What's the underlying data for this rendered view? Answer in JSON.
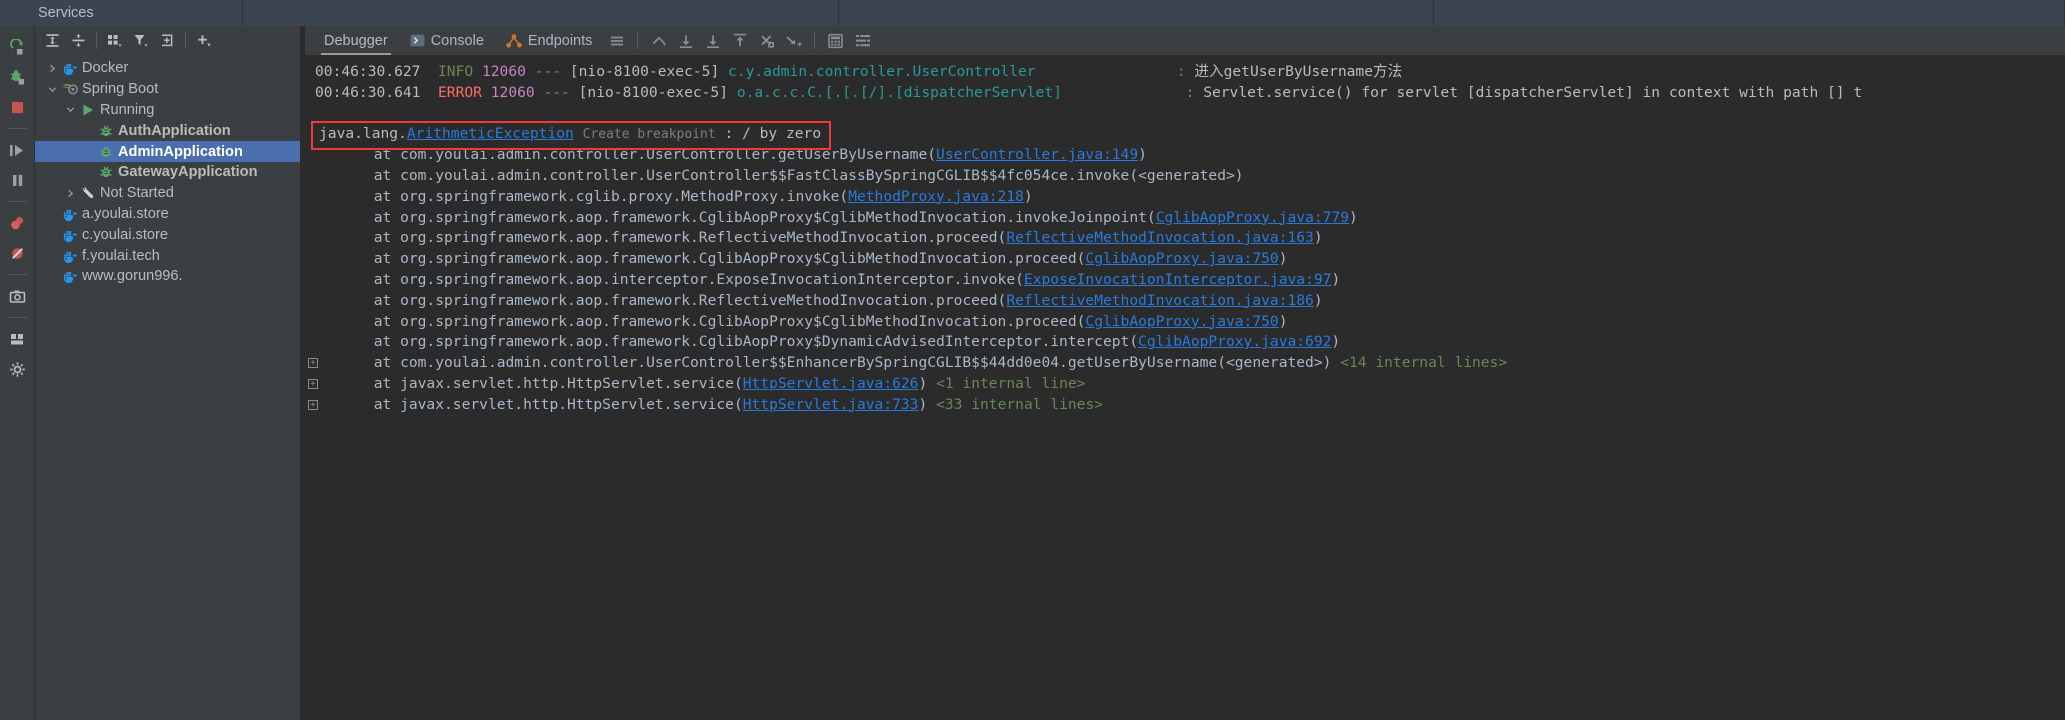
{
  "window": {
    "tabs": [
      {
        "label": "Services"
      },
      {
        "label": ""
      },
      {
        "label": ""
      },
      {
        "label": ""
      }
    ]
  },
  "rail": {
    "buttons": [
      {
        "name": "rerun-icon",
        "title": "Rerun"
      },
      {
        "name": "debug-icon",
        "title": "Debug"
      },
      {
        "name": "stop-icon",
        "title": "Stop"
      },
      {
        "name": "resume-icon",
        "title": "Resume Program"
      },
      {
        "name": "pause-icon",
        "title": "Pause Program"
      },
      {
        "name": "mute-breakpoints-icon",
        "title": "View Breakpoints"
      },
      {
        "name": "mute-breakpoints-off-icon",
        "title": "Mute Breakpoints"
      },
      {
        "name": "camera-icon",
        "title": "Screenshot"
      },
      {
        "name": "layout-icon",
        "title": "Layout"
      },
      {
        "name": "settings-icon",
        "title": "Settings"
      }
    ]
  },
  "tree_toolbar": {
    "buttons": [
      {
        "name": "expand-all-icon",
        "title": "Expand All"
      },
      {
        "name": "collapse-all-icon",
        "title": "Collapse All"
      },
      {
        "name": "group-by-icon",
        "title": "Group By"
      },
      {
        "name": "filter-icon",
        "title": "Filter"
      },
      {
        "name": "add-service-icon",
        "title": "Add Service"
      },
      {
        "name": "plus-icon",
        "title": "Add"
      }
    ]
  },
  "tree": {
    "items": [
      {
        "label": "Docker",
        "indent": 0,
        "twisty": "collapsed",
        "icon": "docker-icon",
        "bold": false,
        "selected": false
      },
      {
        "label": "Spring Boot",
        "indent": 0,
        "twisty": "expanded",
        "icon": "spring-boot-icon",
        "bold": false,
        "selected": false
      },
      {
        "label": "Running",
        "indent": 1,
        "twisty": "expanded",
        "icon": "run-icon",
        "bold": false,
        "selected": false
      },
      {
        "label": "AuthApplication",
        "indent": 2,
        "twisty": "none",
        "icon": "bug-icon",
        "bold": true,
        "selected": false
      },
      {
        "label": "AdminApplication",
        "indent": 2,
        "twisty": "none",
        "icon": "bug-icon",
        "bold": true,
        "selected": true
      },
      {
        "label": "GatewayApplication",
        "indent": 2,
        "twisty": "none",
        "icon": "bug-icon",
        "bold": true,
        "selected": false
      },
      {
        "label": "Not Started",
        "indent": 1,
        "twisty": "collapsed",
        "icon": "wrench-icon",
        "bold": false,
        "selected": false
      },
      {
        "label": "a.youlai.store",
        "indent": 0,
        "twisty": "none",
        "icon": "docker-icon",
        "bold": false,
        "selected": false
      },
      {
        "label": "c.youlai.store",
        "indent": 0,
        "twisty": "none",
        "icon": "docker-icon",
        "bold": false,
        "selected": false
      },
      {
        "label": "f.youlai.tech",
        "indent": 0,
        "twisty": "none",
        "icon": "docker-icon",
        "bold": false,
        "selected": false
      },
      {
        "label": "www.gorun996.",
        "indent": 0,
        "twisty": "none",
        "icon": "docker-icon",
        "bold": false,
        "selected": false
      }
    ]
  },
  "debugger_bar": {
    "tabs": [
      {
        "label": "Debugger",
        "icon": "",
        "active": true
      },
      {
        "label": "Console",
        "icon": "console-icon",
        "active": false
      },
      {
        "label": "Endpoints",
        "icon": "endpoints-icon",
        "active": false
      }
    ],
    "buttons": [
      {
        "name": "menu-icon",
        "title": "Options"
      },
      {
        "name": "step-out-icon",
        "title": "Step Out"
      },
      {
        "name": "step-over-icon",
        "title": "Step Over"
      },
      {
        "name": "step-into-icon",
        "title": "Step Into"
      },
      {
        "name": "force-step-into-icon",
        "title": "Force Step Into"
      },
      {
        "name": "force-step-over-icon",
        "title": "Force Step Over"
      },
      {
        "name": "run-to-cursor-icon",
        "title": "Run to Cursor"
      },
      {
        "name": "evaluate-icon",
        "title": "Evaluate Expression"
      },
      {
        "name": "threads-icon",
        "title": "Threads View"
      }
    ]
  },
  "console": {
    "log_lines": [
      {
        "time": "00:46:30.627",
        "level": "INFO",
        "level_kind": "info",
        "pid": "12060",
        "dashes": "---",
        "thread": "[nio-8100-exec-5]",
        "logger": "c.y.admin.controller.UserController",
        "colon": ":",
        "message": "进入getUserByUsername方法"
      },
      {
        "time": "00:46:30.641",
        "level": "ERROR",
        "level_kind": "error",
        "pid": "12060",
        "dashes": "---",
        "thread": "[nio-8100-exec-5]",
        "logger": "o.a.c.c.C.[.[.[/].[dispatcherServlet]",
        "colon": ":",
        "message": "Servlet.service() for servlet [dispatcherServlet] in context with path [] t"
      }
    ],
    "exception": {
      "prefix": "java.lang.",
      "type": "ArithmeticException",
      "create_breakpoint": "Create breakpoint",
      "suffix": ": / by zero",
      "border_color": "#f03a3a"
    },
    "stack_frames": [
      {
        "fold": false,
        "at": "at ",
        "frame": "com.youlai.admin.controller.UserController.getUserByUsername(",
        "link": "UserController.java:149",
        "tail": ")",
        "note": ""
      },
      {
        "fold": false,
        "at": "at ",
        "frame": "com.youlai.admin.controller.UserController$$FastClassBySpringCGLIB$$4fc054ce.invoke(<generated>)",
        "link": "",
        "tail": "",
        "note": ""
      },
      {
        "fold": false,
        "at": "at ",
        "frame": "org.springframework.cglib.proxy.MethodProxy.invoke(",
        "link": "MethodProxy.java:218",
        "tail": ")",
        "note": ""
      },
      {
        "fold": false,
        "at": "at ",
        "frame": "org.springframework.aop.framework.CglibAopProxy$CglibMethodInvocation.invokeJoinpoint(",
        "link": "CglibAopProxy.java:779",
        "tail": ")",
        "note": ""
      },
      {
        "fold": false,
        "at": "at ",
        "frame": "org.springframework.aop.framework.ReflectiveMethodInvocation.proceed(",
        "link": "ReflectiveMethodInvocation.java:163",
        "tail": ")",
        "note": ""
      },
      {
        "fold": false,
        "at": "at ",
        "frame": "org.springframework.aop.framework.CglibAopProxy$CglibMethodInvocation.proceed(",
        "link": "CglibAopProxy.java:750",
        "tail": ")",
        "note": ""
      },
      {
        "fold": false,
        "at": "at ",
        "frame": "org.springframework.aop.interceptor.ExposeInvocationInterceptor.invoke(",
        "link": "ExposeInvocationInterceptor.java:97",
        "tail": ")",
        "note": ""
      },
      {
        "fold": false,
        "at": "at ",
        "frame": "org.springframework.aop.framework.ReflectiveMethodInvocation.proceed(",
        "link": "ReflectiveMethodInvocation.java:186",
        "tail": ")",
        "note": ""
      },
      {
        "fold": false,
        "at": "at ",
        "frame": "org.springframework.aop.framework.CglibAopProxy$CglibMethodInvocation.proceed(",
        "link": "CglibAopProxy.java:750",
        "tail": ")",
        "note": ""
      },
      {
        "fold": false,
        "at": "at ",
        "frame": "org.springframework.aop.framework.CglibAopProxy$DynamicAdvisedInterceptor.intercept(",
        "link": "CglibAopProxy.java:692",
        "tail": ")",
        "note": ""
      },
      {
        "fold": true,
        "at": "at ",
        "frame": "com.youlai.admin.controller.UserController$$EnhancerBySpringCGLIB$$44dd0e04.getUserByUsername(<generated>)",
        "link": "",
        "tail": "",
        "note": "<14 internal lines>"
      },
      {
        "fold": true,
        "at": "at ",
        "frame": "javax.servlet.http.HttpServlet.service(",
        "link": "HttpServlet.java:626",
        "tail": ")",
        "note": "<1 internal line>"
      },
      {
        "fold": true,
        "at": "at ",
        "frame": "javax.servlet.http.HttpServlet.service(",
        "link": "HttpServlet.java:733",
        "tail": ")",
        "note": "<33 internal lines>"
      }
    ]
  },
  "colors": {
    "background": "#3c3f41",
    "console_background": "#2b2b2b",
    "selection": "#4b6eaf",
    "link": "#287bde",
    "info": "#6a8759",
    "error": "#ff6b68",
    "logger": "#299999",
    "pid": "#c586c0",
    "exception_border": "#f03a3a"
  }
}
